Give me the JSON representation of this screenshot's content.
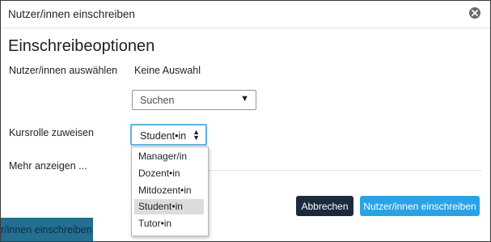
{
  "modal": {
    "title": "Nutzer/innen einschreiben",
    "section_title": "Einschreibeoptionen"
  },
  "users": {
    "label": "Nutzer/innen auswählen",
    "selection": "Keine Auswahl",
    "search_placeholder": "Suchen"
  },
  "role": {
    "label": "Kursrolle zuweisen",
    "selected": "Student•in",
    "options": [
      "Manager/in",
      "Dozent•in",
      "Mitdozent•in",
      "Student•in",
      "Tutor•in"
    ],
    "highlighted_index": 3
  },
  "more_link": "Mehr anzeigen ...",
  "buttons": {
    "cancel": "Abbrechen",
    "enrol": "Nutzer/innen einschreiben"
  },
  "background_button": "r/innen einschreiben",
  "colors": {
    "primary": "#2aa3e6",
    "cancel": "#1d2a3d",
    "background_button": "#236f91",
    "focus_ring": "#5bb3e6"
  },
  "icons": {
    "close": "close-circle-icon",
    "search_caret": "triangle-down-icon",
    "select_caret": "up-down-caret-icon"
  }
}
